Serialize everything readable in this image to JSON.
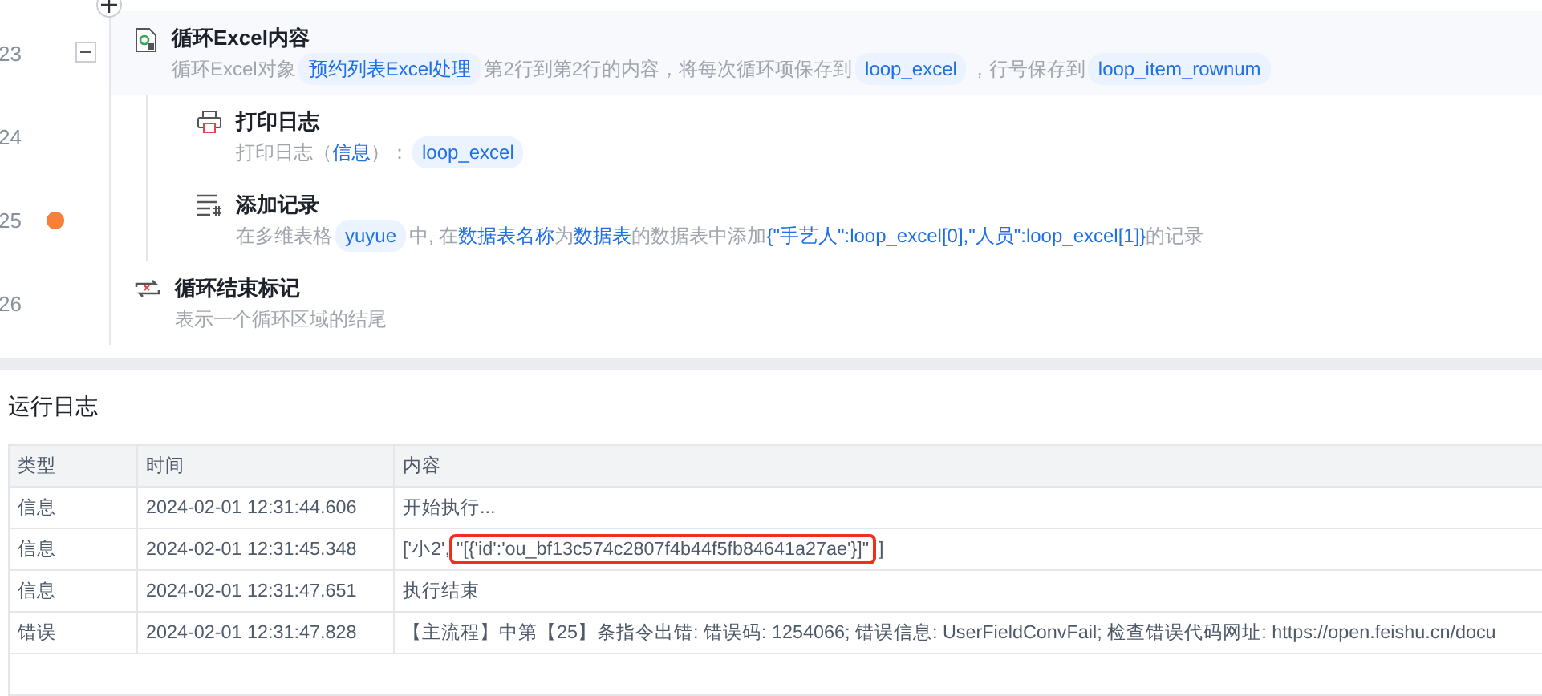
{
  "steps": [
    {
      "number": "23",
      "breakpoint": false,
      "expanded": true,
      "selected": true,
      "kind": "loop",
      "title": "循环Excel内容",
      "description": [
        {
          "kind": "text",
          "text": "循环Excel对象"
        },
        {
          "kind": "chip",
          "text": "预约列表Excel处理"
        },
        {
          "kind": "text",
          "text": "第2行到第2行的内容，将每次循环项保存到"
        },
        {
          "kind": "chip",
          "text": "loop_excel"
        },
        {
          "kind": "text",
          "text": "，行号保存到"
        },
        {
          "kind": "chip",
          "text": "loop_item_rownum"
        }
      ],
      "children": [
        {
          "number": "24",
          "breakpoint": false,
          "selected": false,
          "kind": "print",
          "title": "打印日志",
          "description": [
            {
              "kind": "text",
              "text": "打印日志（"
            },
            {
              "kind": "link",
              "text": "信息"
            },
            {
              "kind": "text",
              "text": "）："
            },
            {
              "kind": "chip",
              "text": "loop_excel"
            }
          ]
        },
        {
          "number": "25",
          "breakpoint": true,
          "selected": false,
          "kind": "record",
          "title": "添加记录",
          "description": [
            {
              "kind": "text",
              "text": "在多维表格"
            },
            {
              "kind": "chip",
              "text": "yuyue"
            },
            {
              "kind": "text",
              "text": "中, 在"
            },
            {
              "kind": "link",
              "text": "数据表名称"
            },
            {
              "kind": "text",
              "text": "为"
            },
            {
              "kind": "link",
              "text": "数据表"
            },
            {
              "kind": "text",
              "text": "的数据表中添加"
            },
            {
              "kind": "link",
              "text": "{\"手艺人\":loop_excel[0],\"人员\":loop_excel[1]}"
            },
            {
              "kind": "text",
              "text": "的记录"
            }
          ]
        }
      ]
    },
    {
      "number": "26",
      "breakpoint": false,
      "selected": false,
      "kind": "loop_end",
      "title": "循环结束标记",
      "description": [
        {
          "kind": "text",
          "text": "表示一个循环区域的结尾"
        }
      ]
    }
  ],
  "log": {
    "title": "运行日志",
    "columns": [
      "类型",
      "时间",
      "内容"
    ],
    "rows": [
      {
        "type": "信息",
        "time": "2024-02-01 12:31:44.606",
        "content": [
          {
            "text": "开始执行...",
            "highlighted": false
          }
        ]
      },
      {
        "type": "信息",
        "time": "2024-02-01 12:31:45.348",
        "content": [
          {
            "text": "['小2', ",
            "highlighted": false
          },
          {
            "text": "\"[{'id':'ou_bf13c574c2807f4b44f5fb84641a27ae'}]\"",
            "highlighted": true
          },
          {
            "text": "]",
            "highlighted": false
          }
        ]
      },
      {
        "type": "信息",
        "time": "2024-02-01 12:31:47.651",
        "content": [
          {
            "text": "执行结束",
            "highlighted": false
          }
        ]
      },
      {
        "type": "错误",
        "time": "2024-02-01 12:31:47.828",
        "content": [
          {
            "text": "【主流程】中第【25】条指令出错:  错误码: 1254066; 错误信息: UserFieldConvFail; 检查错误代码网址: https://open.feishu.cn/docu",
            "highlighted": false
          }
        ]
      }
    ]
  }
}
